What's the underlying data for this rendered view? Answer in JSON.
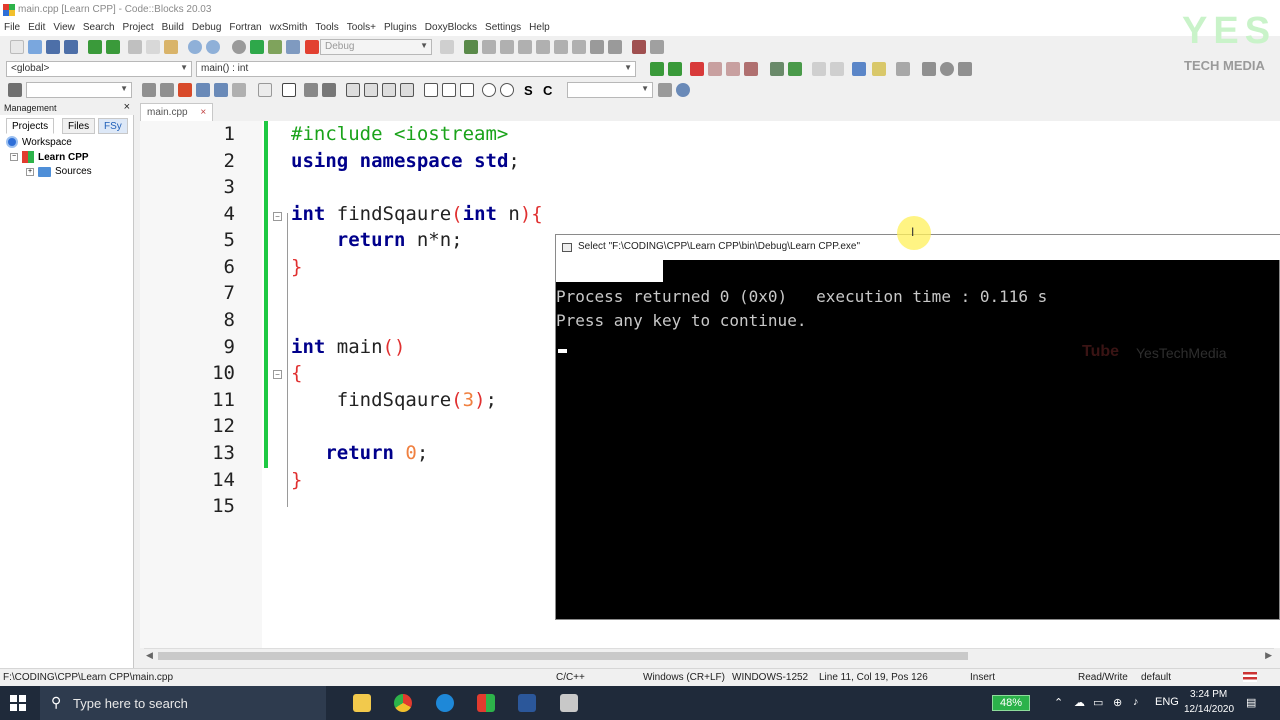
{
  "window": {
    "title": "main.cpp [Learn CPP] - Code::Blocks 20.03"
  },
  "menu": [
    "File",
    "Edit",
    "View",
    "Search",
    "Project",
    "Build",
    "Debug",
    "Fortran",
    "wxSmith",
    "Tools",
    "Tools+",
    "Plugins",
    "DoxyBlocks",
    "Settings",
    "Help"
  ],
  "toolbar": {
    "build_target": "Debug",
    "scope": "<global>",
    "symbol": "main() : int"
  },
  "management": {
    "title": "Management",
    "tabs": [
      "Projects",
      "Files",
      "FSy"
    ],
    "tree": {
      "workspace": "Workspace",
      "project": "Learn CPP",
      "folder": "Sources"
    }
  },
  "editor": {
    "tab": "main.cpp",
    "close_glyph": "×",
    "lines": [
      {
        "n": "1",
        "code": "#include <iostream>"
      },
      {
        "n": "2",
        "code": "using namespace std;"
      },
      {
        "n": "3",
        "code": ""
      },
      {
        "n": "4",
        "code": "int findSqaure(int n){"
      },
      {
        "n": "5",
        "code": "    return n*n;"
      },
      {
        "n": "6",
        "code": "}"
      },
      {
        "n": "7",
        "code": ""
      },
      {
        "n": "8",
        "code": ""
      },
      {
        "n": "9",
        "code": "int main()"
      },
      {
        "n": "10",
        "code": "{"
      },
      {
        "n": "11",
        "code": "    findSqaure(3);"
      },
      {
        "n": "12",
        "code": ""
      },
      {
        "n": "13",
        "code": "   return 0;"
      },
      {
        "n": "14",
        "code": "}"
      },
      {
        "n": "15",
        "code": ""
      }
    ]
  },
  "console": {
    "title": "Select \"F:\\CODING\\CPP\\Learn CPP\\bin\\Debug\\Learn CPP.exe\"",
    "line1": "Process returned 0 (0x0)   execution time : 0.116 s",
    "line2": "Press any key to continue."
  },
  "status": {
    "path": "F:\\CODING\\CPP\\Learn CPP\\main.cpp",
    "language": "C/C++",
    "eol": "Windows (CR+LF)",
    "encoding": "WINDOWS-1252",
    "position": "Line 11, Col 19, Pos 126",
    "mode": "Insert",
    "access": "Read/Write",
    "profile": "default"
  },
  "watermark": {
    "brand": "YES",
    "sub": "TECH MEDIA",
    "tube": "Tube",
    "channel": "YesTechMedia"
  },
  "taskbar": {
    "search_placeholder": "Type here to search",
    "battery": "48%",
    "lang": "ENG",
    "time": "3:24 PM",
    "date": "12/14/2020"
  },
  "colors": {
    "accent_green": "#1ec943",
    "keyword": "#00008b",
    "number": "#f08040",
    "preprocessor": "#1aa31a",
    "taskbar": "#1f2a3a"
  }
}
